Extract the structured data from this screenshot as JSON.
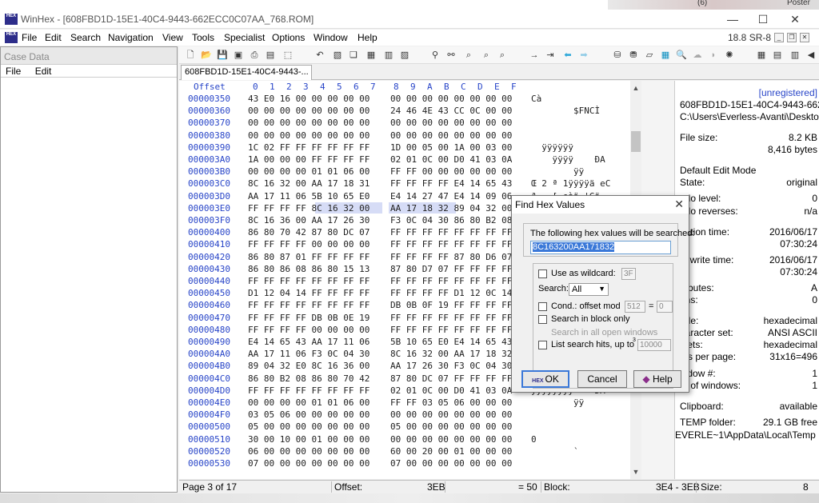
{
  "window": {
    "title": "WinHex - [608FBD1D-15E1-40C4-9443-662ECC0C07AA_768.ROM]",
    "app_icon": "HEX",
    "controls": [
      "minimize-icon",
      "maximize-icon",
      "close-icon"
    ]
  },
  "desktop": {
    "corner_text_1": "(6)",
    "corner_text_2": "Poster",
    "corner_text_3": "(3)"
  },
  "menubar": {
    "items": [
      "File",
      "Edit",
      "Search",
      "Navigation",
      "View",
      "Tools",
      "Specialist",
      "Options",
      "Window",
      "Help"
    ],
    "version": "18.8 SR-8"
  },
  "case_panel": {
    "title": "Case Data",
    "menu": [
      "File",
      "Edit"
    ]
  },
  "doc_tab": "608FBD1D-15E1-40C4-9443-...",
  "hex": {
    "header_offset": "Offset",
    "header_cols": [
      "0",
      "1",
      "2",
      "3",
      "4",
      "5",
      "6",
      "7",
      "8",
      "9",
      "A",
      "B",
      "C",
      "D",
      "E",
      "F"
    ],
    "rows": [
      {
        "off": "00000350",
        "b1": "43 E0 16 00 00 00 00 00",
        "b2": "00 00 00 00 00 00 00 00",
        "txt": "Cà"
      },
      {
        "off": "00000360",
        "b1": "00 00 00 00 00 00 00 00",
        "b2": "24 46 4E 43 CC 0C 00 00",
        "txt": "        $FNCÌ"
      },
      {
        "off": "00000370",
        "b1": "00 00 00 00 00 00 00 00",
        "b2": "00 00 00 00 00 00 00 00",
        "txt": ""
      },
      {
        "off": "00000380",
        "b1": "00 00 00 00 00 00 00 00",
        "b2": "00 00 00 00 00 00 00 00",
        "txt": ""
      },
      {
        "off": "00000390",
        "b1": "1C 02 FF FF FF FF FF FF",
        "b2": "1D 00 05 00 1A 00 03 00",
        "txt": "  ÿÿÿÿÿÿ"
      },
      {
        "off": "000003A0",
        "b1": "1A 00 00 00 FF FF FF FF",
        "b2": "02 01 0C 00 D0 41 03 0A",
        "txt": "    ÿÿÿÿ    ÐA"
      },
      {
        "off": "000003B0",
        "b1": "00 00 00 00 01 01 06 00",
        "b2": "FF FF 00 00 00 00 00 00",
        "txt": "        ÿÿ"
      },
      {
        "off": "000003C0",
        "b1": "8C 16 32 00 AA 17 18 31",
        "b2": "FF FF FF FF E4 14 65 43",
        "txt": "Œ 2 ª 1ÿÿÿÿä eC"
      },
      {
        "off": "000003D0",
        "b1": "AA 17 11 06 5B 10 65 E0",
        "b2": "E4 14 27 47 E4 14 09 06",
        "txt": "ª   [ eàä 'Gä"
      },
      {
        "off": "000003E0",
        "b1": "FF FF FF FF 8C 16 32 00",
        "b2": "AA 17 18 32 89 04 32 00",
        "txt": "ÿÿÿÿŒ 2 ª 2‰ 2"
      },
      {
        "off": "000003F0",
        "b1": "8C 16 36 00 AA 17 26 30",
        "b2": "F3 0C 04 30 86 80 B2 08",
        "txt": "Œ 6 ª &0ó  0†€²"
      },
      {
        "off": "00000400",
        "b1": "86 80 70 42 87 80 DC 07",
        "b2": "FF FF FF FF FF FF FF FF",
        "txt": "†€pB‡€Ü ÿÿÿÿÿÿÿÿ"
      },
      {
        "off": "00000410",
        "b1": "FF FF FF FF 00 00 00 00",
        "b2": "FF FF FF FF FF FF FF FF",
        "txt": "ÿÿÿÿ    ÿÿÿÿÿÿÿÿ"
      },
      {
        "off": "00000420",
        "b1": "86 80 87 01 FF FF FF FF",
        "b2": "FF FF FF FF 87 80 D6 07",
        "txt": "†€‡ ÿÿÿÿÿÿÿÿ‡€Ö"
      },
      {
        "off": "00000430",
        "b1": "86 80 86 08 86 80 15 13",
        "b2": "87 80 D7 07 FF FF FF FF",
        "txt": "†€† †€  ‡€× ÿÿÿÿ"
      },
      {
        "off": "00000440",
        "b1": "FF FF FF FF FF FF FF FF",
        "b2": "FF FF FF FF FF FF FF FF",
        "txt": "ÿÿÿÿÿÿÿÿÿÿÿÿÿÿÿÿ"
      },
      {
        "off": "00000450",
        "b1": "D1 12 04 14 FF FF FF FF",
        "b2": "FF FF FF FF D1 12 0C 14",
        "txt": "Ñ   ÿÿÿÿÿÿÿÿÑ"
      },
      {
        "off": "00000460",
        "b1": "FF FF FF FF FF FF FF FF",
        "b2": "DB 0B 0F 19 FF FF FF FF",
        "txt": "ÿÿÿÿÿÿÿÿÛ   ÿÿÿÿ"
      },
      {
        "off": "00000470",
        "b1": "FF FF FF FF DB 0B 0E 19",
        "b2": "FF FF FF FF FF FF FF FF",
        "txt": "ÿÿÿÿÛ   ÿÿÿÿÿÿÿÿ"
      },
      {
        "off": "00000480",
        "b1": "FF FF FF FF 00 00 00 00",
        "b2": "FF FF FF FF FF FF FF FF",
        "txt": "ÿÿÿÿ    ÿÿÿÿÿÿÿÿ"
      },
      {
        "off": "00000490",
        "b1": "E4 14 65 43 AA 17 11 06",
        "b2": "5B 10 65 E0 E4 14 65 43",
        "txt": "ä eCª   [ eàä eC"
      },
      {
        "off": "000004A0",
        "b1": "AA 17 11 06 F3 0C 04 30",
        "b2": "8C 16 32 00 AA 17 18 32",
        "txt": "ª   ó  0Œ 2 ª  2"
      },
      {
        "off": "000004B0",
        "b1": "89 04 32 E0 8C 16 36 00",
        "b2": "AA 17 26 30 F3 0C 04 30",
        "txt": "‰ 2àŒ 6 ª &0ó  0"
      },
      {
        "off": "000004C0",
        "b1": "86 80 B2 08 86 80 70 42",
        "b2": "87 80 DC 07 FF FF FF FF",
        "txt": "†€² †€pB‡€Ü ÿÿÿÿ"
      },
      {
        "off": "000004D0",
        "b1": "FF FF FF FF FF FF FF FF",
        "b2": "02 01 0C 00 D0 41 03 0A",
        "txt": "ÿÿÿÿÿÿÿÿ    ÐA"
      },
      {
        "off": "000004E0",
        "b1": "00 00 00 00 01 01 06 00",
        "b2": "FF FF 03 05 06 00 00 00",
        "txt": "        ÿÿ"
      },
      {
        "off": "000004F0",
        "b1": "03 05 06 00 00 00 00 00",
        "b2": "00 00 00 00 00 00 00 00",
        "txt": ""
      },
      {
        "off": "00000500",
        "b1": "05 00 00 00 00 00 00 00",
        "b2": "05 00 00 00 00 00 00 00",
        "txt": ""
      },
      {
        "off": "00000510",
        "b1": "30 00 10 00 01 00 00 00",
        "b2": "00 00 00 00 00 00 00 00",
        "txt": "0"
      },
      {
        "off": "00000520",
        "b1": "06 00 00 00 00 00 00 00",
        "b2": "60 00 20 00 01 00 00 00",
        "txt": "        `"
      },
      {
        "off": "00000530",
        "b1": "07 00 00 00 00 00 00 00",
        "b2": "07 00 00 00 00 00 00 00",
        "txt": ""
      }
    ]
  },
  "info": {
    "unregistered": "[unregistered]",
    "filename": "608FBD1D-15E1-40C4-9443-662",
    "path": "C:\\Users\\Everless-Avanti\\Desktop",
    "file_size_label": "File size:",
    "file_size_kb": "8.2 KB",
    "file_size_bytes": "8,416 bytes",
    "edit_mode_label": "Default Edit Mode",
    "state_label": "State:",
    "state_value": "original",
    "undo_level_label": "ndo level:",
    "undo_level_value": "0",
    "undo_reverses_label": "ndo reverses:",
    "undo_reverses_value": "n/a",
    "creation_label": "eation time:",
    "creation_date": "2016/06/17",
    "creation_time": "07:30:24",
    "lastwrite_label": "st write time:",
    "lastwrite_date": "2016/06/17",
    "lastwrite_time": "07:30:24",
    "attributes_label": "tributes:",
    "attributes_value": "A",
    "icons_label": "ons:",
    "icons_value": "0",
    "mode_label": "ode:",
    "mode_value": "hexadecimal",
    "charset_label": "haracter set:",
    "charset_value": "ANSI ASCII",
    "offsets_label": "fsets:",
    "offsets_value": "hexadecimal",
    "bpp_label": "tes per page:",
    "bpp_value": "31x16=496",
    "window_label": "indow #:",
    "window_value": "1",
    "windows_label": "o. of windows:",
    "windows_value": "1",
    "clipboard_label": "Clipboard:",
    "clipboard_value": "available",
    "temp_label": "TEMP folder:",
    "temp_value": "29.1 GB free",
    "temp_path": "EVERLE~1\\AppData\\Local\\Temp"
  },
  "status": {
    "page": "Page 3 of 17",
    "offset_label": "Offset:",
    "offset_value": "3EB",
    "value": "= 50",
    "block_label": "Block:",
    "block_value": "3E4 - 3EB",
    "size_label": "Size:",
    "size_value": "8"
  },
  "dialog": {
    "title": "Find Hex Values",
    "prompt": "The following hex values will be searched:",
    "hex_value": "8C163200AA171832",
    "wildcard_label": "Use as wildcard:",
    "wildcard_value": "3F",
    "search_label": "Search:",
    "search_value": "All",
    "cond_label": "Cond.: offset mod",
    "cond_mod": "512",
    "cond_eq": "=",
    "cond_value": "0",
    "block_only": "Search in block only",
    "all_windows": "Search in all open windows",
    "list_hits": "List search hits, up to",
    "list_hits_sup": "3",
    "list_max": "10000",
    "ok": "OK",
    "cancel": "Cancel",
    "help": "Help"
  }
}
